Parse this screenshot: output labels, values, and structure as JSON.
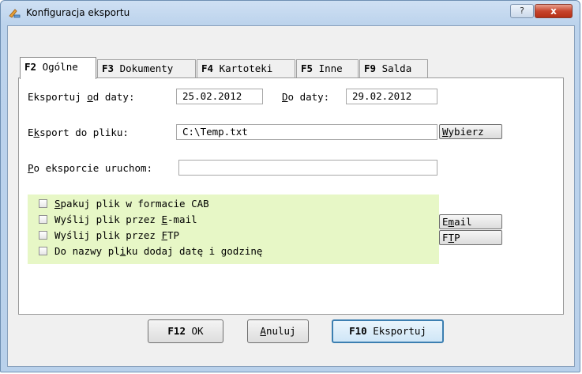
{
  "window": {
    "title": "Konfiguracja eksportu",
    "help_label": "?",
    "close_label": "x"
  },
  "tabs": [
    {
      "key": "F2",
      "label": "Ogólne",
      "active": true
    },
    {
      "key": "F3",
      "label": "Dokumenty",
      "active": false
    },
    {
      "key": "F4",
      "label": "Kartoteki",
      "active": false
    },
    {
      "key": "F5",
      "label": "Inne",
      "active": false
    },
    {
      "key": "F9",
      "label": "Salda",
      "active": false
    }
  ],
  "form": {
    "date_from_label_pre": "Eksportuj ",
    "date_from_label_acc": "o",
    "date_from_label_post": "d daty:",
    "date_from_value": "25.02.2012",
    "date_to_label_acc": "D",
    "date_to_label_post": "o daty:",
    "date_to_value": "29.02.2012",
    "file_label_pre": "E",
    "file_label_acc": "k",
    "file_label_post": "sport do pliku:",
    "file_value": "C:\\Temp.txt",
    "choose_label_acc": "W",
    "choose_label_post": "ybierz",
    "run_label_acc": "P",
    "run_label_post": "o eksporcie uruchom:",
    "run_value": ""
  },
  "options": [
    {
      "pre": "",
      "acc": "S",
      "post": "pakuj plik w formacie CAB",
      "checked": false
    },
    {
      "pre": "Wyślij plik przez ",
      "acc": "E",
      "post": "-mail",
      "checked": false
    },
    {
      "pre": "Wyślij plik przez ",
      "acc": "F",
      "post": "TP",
      "checked": false
    },
    {
      "pre": "Do nazwy pl",
      "acc": "i",
      "post": "ku dodaj datę i godzinę",
      "checked": false
    }
  ],
  "side_buttons": {
    "email_pre": "E",
    "email_acc": "m",
    "email_post": "ail",
    "ftp_pre": "F",
    "ftp_acc": "T",
    "ftp_post": "P"
  },
  "footer": {
    "ok_key": "F12",
    "ok_label": "OK",
    "cancel_acc": "A",
    "cancel_post": "nuluj",
    "export_key": "F10",
    "export_label": "Eksportuj"
  }
}
